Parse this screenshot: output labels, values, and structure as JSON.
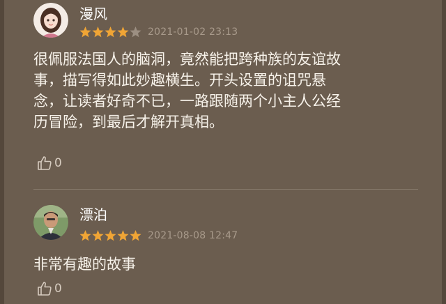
{
  "comments": [
    {
      "username": "漫风",
      "rating": 4,
      "max_rating": 5,
      "timestamp": "2021-01-02 23:13",
      "text_lines": [
        "很佩服法国人的脑洞，竟然能把跨种族的友谊故",
        "事，描写得如此妙趣横生。开头设置的诅咒悬",
        "念，让读者好奇不已，一路跟随两个小主人公经",
        "历冒险，到最后才解开真相。"
      ],
      "likes": "0"
    },
    {
      "username": "漂泊",
      "rating": 5,
      "max_rating": 5,
      "timestamp": "2021-08-08 12:47",
      "text_lines": [
        "非常有趣的故事"
      ],
      "likes": "0"
    }
  ],
  "colors": {
    "background": "#6b5d4f",
    "star_filled": "#f0a535",
    "star_empty": "#9c8f82",
    "timestamp": "#a89a8b"
  },
  "icons": {
    "like": "thumbs-up-icon",
    "star": "star-icon"
  }
}
